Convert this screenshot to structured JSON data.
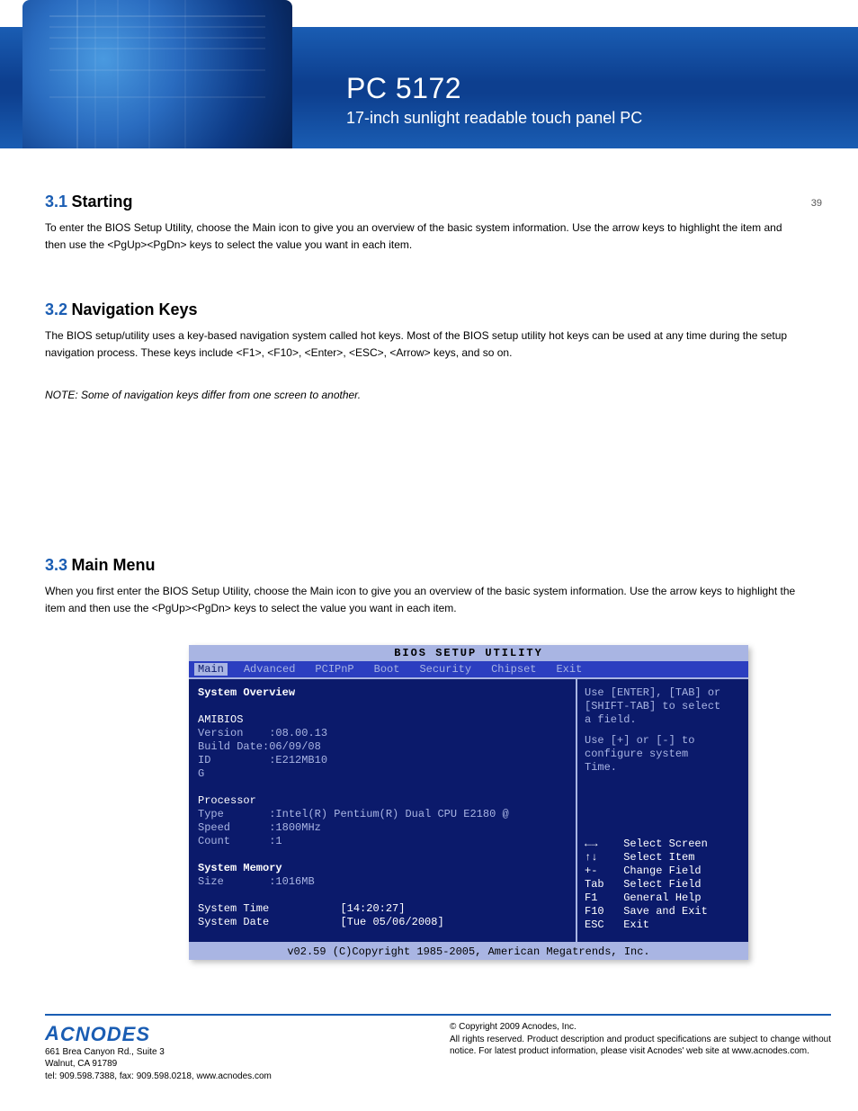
{
  "header": {
    "model": "PC 5172",
    "subtitle": "17-inch sunlight readable touch panel PC"
  },
  "page_number": "39",
  "sections": {
    "s31": {
      "num": "3.1",
      "title": "Starting"
    },
    "s31_body": "To enter the BIOS Setup Utility, choose the Main icon to give you an overview of the basic system information.  Use the arrow keys to highlight the item and then use the <PgUp><PgDn> keys to select the value you want in each item.",
    "s32": {
      "num": "3.2",
      "title": "Navigation Keys"
    },
    "s32_body1": "The BIOS setup/utility uses a key-based navigation system called hot keys. Most of the BIOS setup utility hot keys can be used at any time during the setup navigation process. These keys include <F1>, <F10>, <Enter>, <ESC>, <Arrow> keys, and so on.",
    "s32_note": "NOTE: Some of navigation keys differ from one screen to another.",
    "s33": {
      "num": "3.3",
      "title": "Main Menu"
    },
    "s33_body": "When you first enter the BIOS Setup Utility, choose the Main icon to give you an overview of the basic system information.  Use the arrow keys to highlight the item and then use the <PgUp><PgDn> keys to select the value you want in each item."
  },
  "bios": {
    "title": "BIOS  SETUP  UTILITY",
    "menu": [
      "Main",
      "Advanced",
      "PCIPnP",
      "Boot",
      "Security",
      "Chipset",
      "Exit"
    ],
    "left": {
      "overview": "System Overview",
      "amibios": "AMIBIOS",
      "version_l": "Version",
      "version_v": ":08.00.13",
      "build_l": "Build Date",
      "build_v": ":06/09/08",
      "id_l": "ID",
      "id_v": ":E212MB10",
      "g": "G",
      "processor": "Processor",
      "type_l": "Type",
      "type_v": ":Intel(R) Pentium(R) Dual CPU E2180 @",
      "speed_l": "Speed",
      "speed_v": ":1800MHz",
      "count_l": "Count",
      "count_v": ":1",
      "memory": "System Memory",
      "size_l": "Size",
      "size_v": ":1016MB",
      "time_l": "System Time",
      "time_v": "[14:20:27]",
      "date_l": "System Date",
      "date_v": "[Tue 05/06/2008]"
    },
    "right": {
      "help1": "Use [ENTER], [TAB] or",
      "help2": "[SHIFT-TAB] to select",
      "help3": "a field.",
      "help4": "Use [+] or [-] to",
      "help5": "configure system",
      "help6": "Time.",
      "keys": [
        "←→    Select Screen",
        "↑↓    Select Item",
        "+-    Change Field",
        "Tab   Select Field",
        "F1    General Help",
        "F10   Save and Exit",
        "ESC   Exit"
      ]
    },
    "footer": "v02.59 (C)Copyright 1985-2005, American Megatrends, Inc."
  },
  "footer": {
    "logo": "ACNODES",
    "addr1": "661 Brea Canyon Rd., Suite 3",
    "addr2": "Walnut, CA 91789",
    "addr3": "tel: 909.598.7388, fax: 909.598.0218, www.acnodes.com",
    "right1": "© Copyright 2009 Acnodes, Inc.",
    "right2": "All rights reserved. Product description and product specifications are subject to change without notice. For latest product information, please visit Acnodes' web site at www.acnodes.com."
  }
}
